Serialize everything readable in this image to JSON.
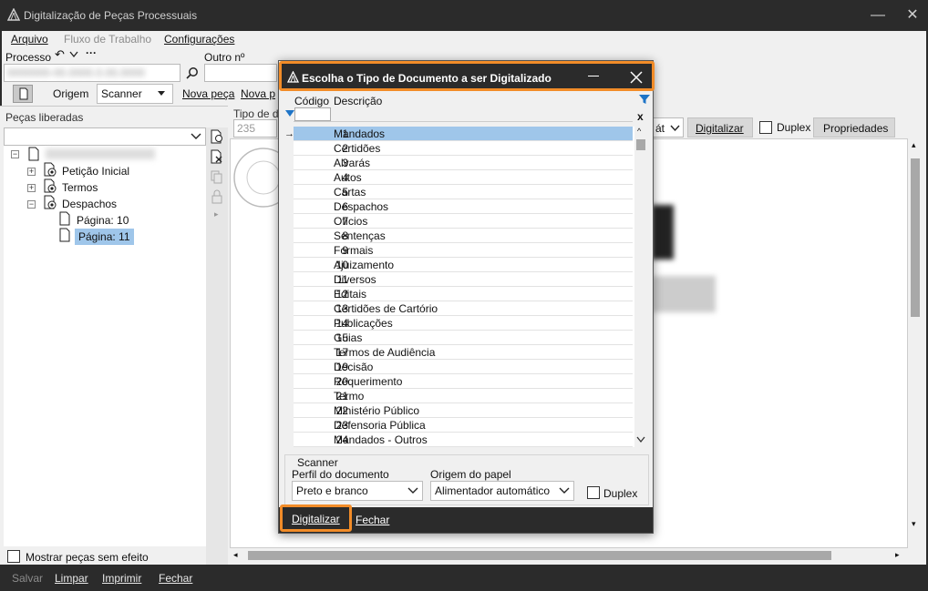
{
  "window": {
    "title": "Digitalização de Peças Processuais",
    "minimize": "—",
    "close": "✕"
  },
  "menu": {
    "arquivo": "Arquivo",
    "fluxo": "Fluxo de Trabalho",
    "configuracoes": "Configurações"
  },
  "form": {
    "processo_label": "Processo",
    "processo_value": "0000000-00.0000.0.00.0000",
    "outro_label": "Outro nº",
    "origem_label": "Origem",
    "origem_value": "Scanner",
    "nova_peca": "Nova peça",
    "nova_p": "Nova p",
    "tipo_label": "Tipo de d",
    "tipo_value": "235"
  },
  "left": {
    "title": "Peças liberadas",
    "tree": [
      {
        "label": "Petição Inicial"
      },
      {
        "label": "Termos"
      },
      {
        "label": "Despachos"
      },
      {
        "label": "Página: 10"
      },
      {
        "label": "Página: 11"
      }
    ],
    "show_no_effect": "Mostrar peças sem efeito"
  },
  "right_toolbar": {
    "fmt": "át",
    "digitalizar": "Digitalizar",
    "duplex": "Duplex",
    "propriedades": "Propriedades"
  },
  "bottom": {
    "salvar": "Salvar",
    "limpar": "Limpar",
    "imprimir": "Imprimir",
    "fechar": "Fechar"
  },
  "dialog": {
    "title": "Escolha o Tipo de Documento a ser Digitalizado",
    "col_codigo": "Código",
    "col_descricao": "Descrição",
    "clear": "x",
    "rows": [
      {
        "code": "1",
        "desc": "Mandados"
      },
      {
        "code": "2",
        "desc": "Certidões"
      },
      {
        "code": "3",
        "desc": "Alvarás"
      },
      {
        "code": "4",
        "desc": "Autos"
      },
      {
        "code": "5",
        "desc": "Cartas"
      },
      {
        "code": "6",
        "desc": "Despachos"
      },
      {
        "code": "7",
        "desc": "Ofícios"
      },
      {
        "code": "8",
        "desc": "Sentenças"
      },
      {
        "code": "9",
        "desc": "Formais"
      },
      {
        "code": "10",
        "desc": "Ajuizamento"
      },
      {
        "code": "11",
        "desc": "Diversos"
      },
      {
        "code": "12",
        "desc": "Editais"
      },
      {
        "code": "13",
        "desc": "Certidões de Cartório"
      },
      {
        "code": "14",
        "desc": "Publicações"
      },
      {
        "code": "15",
        "desc": "Guias"
      },
      {
        "code": "17",
        "desc": "Termos de Audiência"
      },
      {
        "code": "19",
        "desc": "Decisão"
      },
      {
        "code": "20",
        "desc": "Requerimento"
      },
      {
        "code": "21",
        "desc": "Termo"
      },
      {
        "code": "22",
        "desc": "Ministério Público"
      },
      {
        "code": "23",
        "desc": "Defensoria Pública"
      },
      {
        "code": "24",
        "desc": "Mandados - Outros"
      }
    ],
    "scanner_group": "Scanner",
    "perfil_label": "Perfil do documento",
    "perfil_value": "Preto e branco",
    "origem_label": "Origem do papel",
    "origem_value": "Alimentador automático",
    "duplex": "Duplex",
    "btn_digitalizar": "Digitalizar",
    "btn_fechar": "Fechar"
  },
  "colors": {
    "highlight": "#f28c28",
    "selection": "#9fc6ea",
    "dark": "#2b2b2b"
  }
}
